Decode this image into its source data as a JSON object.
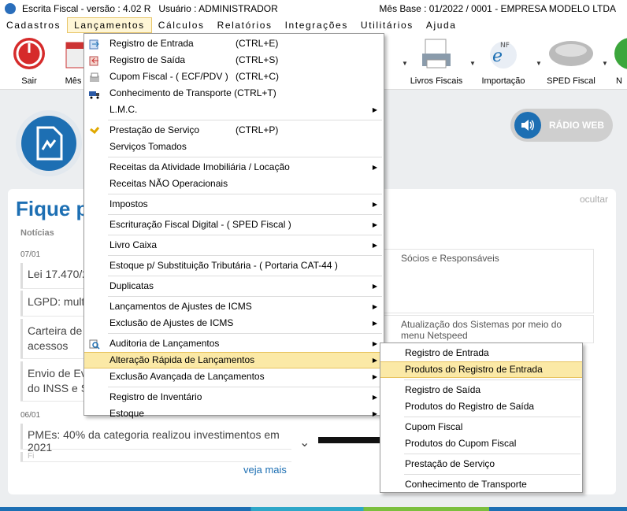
{
  "titlebar": {
    "title": "Escrita Fiscal - versão : 4.02 R",
    "user": "Usuário : ADMINISTRADOR",
    "base": "Mês Base : 01/2022 / 0001 - EMPRESA MODELO LTDA"
  },
  "menubar": [
    "Cadastros",
    "Lançamentos",
    "Cálculos",
    "Relatórios",
    "Integrações",
    "Utilitários",
    "Ajuda"
  ],
  "toolbar": {
    "sair": "Sair",
    "mes": "Mês",
    "livros": "Livros Fiscais",
    "importacao": "Importação",
    "sped": "SPED Fiscal",
    "n": "N"
  },
  "radio": "RÁDIO WEB",
  "fique": "Fique p",
  "ocultar": "ocultar",
  "noticias_header": "Notícias",
  "dates": [
    "07/01",
    "06/01"
  ],
  "news": [
    "Lei 17.470/2",
    "LGPD: multa",
    "Carteira de T\nacessos",
    "Envio de Eve\ndo INSS e S",
    "PMEs: 40% da categoria realizou investimentos em 2021",
    "Fi"
  ],
  "veja_mais": "veja mais",
  "cards": [
    "Sócios e Responsáveis",
    "Atualização dos Sistemas por meio do menu Netspeed"
  ],
  "menu_lancamentos": [
    {
      "label": "Registro de Entrada",
      "shortcut": "(CTRL+E)",
      "icon": "entrada-icon"
    },
    {
      "label": "Registro de Saída",
      "shortcut": "(CTRL+S)",
      "icon": "saida-icon"
    },
    {
      "label": "Cupom Fiscal - ( ECF/PDV )",
      "shortcut": "(CTRL+C)",
      "icon": "cupom-icon"
    },
    {
      "label": "Conhecimento de Transporte (CTRL+T)",
      "shortcut": "",
      "icon": "truck-icon"
    },
    {
      "label": "L.M.C.",
      "shortcut": "",
      "sub": true
    },
    {
      "sep": true
    },
    {
      "label": "Prestação de Serviço",
      "shortcut": "(CTRL+P)",
      "icon": "servico-icon"
    },
    {
      "label": "Serviços Tomados",
      "shortcut": ""
    },
    {
      "sep": true
    },
    {
      "label": "Receitas da Atividade Imobiliária / Locação",
      "shortcut": "",
      "sub": true
    },
    {
      "label": "Receitas NÃO Operacionais",
      "shortcut": ""
    },
    {
      "sep": true
    },
    {
      "label": "Impostos",
      "shortcut": "",
      "sub": true
    },
    {
      "sep": true
    },
    {
      "label": "Escrituração Fiscal Digital - ( SPED Fiscal )",
      "shortcut": "",
      "sub": true
    },
    {
      "sep": true
    },
    {
      "label": "Livro Caixa",
      "shortcut": "",
      "sub": true
    },
    {
      "sep": true
    },
    {
      "label": "Estoque p/ Substituição Tributária - ( Portaria CAT-44 )",
      "shortcut": ""
    },
    {
      "sep": true
    },
    {
      "label": "Duplicatas",
      "shortcut": "",
      "sub": true
    },
    {
      "sep": true
    },
    {
      "label": "Lançamentos de Ajustes de ICMS",
      "shortcut": "",
      "sub": true
    },
    {
      "label": "Exclusão de Ajustes de ICMS",
      "shortcut": "",
      "sub": true
    },
    {
      "sep": true
    },
    {
      "label": "Auditoria de Lançamentos",
      "shortcut": "",
      "sub": true,
      "icon": "auditoria-icon"
    },
    {
      "label": "Alteração Rápida de Lançamentos",
      "shortcut": "",
      "sub": true,
      "hl": true
    },
    {
      "label": "Exclusão Avançada de Lançamentos",
      "shortcut": "",
      "sub": true
    },
    {
      "sep": true
    },
    {
      "label": "Registro de Inventário",
      "shortcut": "",
      "sub": true
    },
    {
      "label": "Estoque",
      "shortcut": "",
      "sub": true
    }
  ],
  "menu_alteracao": [
    {
      "label": "Registro de Entrada"
    },
    {
      "label": "Produtos do Registro de Entrada",
      "hl": true
    },
    {
      "sep": true
    },
    {
      "label": "Registro de Saída"
    },
    {
      "label": "Produtos do Registro de Saída"
    },
    {
      "sep": true
    },
    {
      "label": "Cupom Fiscal"
    },
    {
      "label": "Produtos do Cupom Fiscal"
    },
    {
      "sep": true
    },
    {
      "label": "Prestação de Serviço"
    },
    {
      "sep": true
    },
    {
      "label": "Conhecimento de Transporte"
    }
  ],
  "colors": {
    "accent": "#1d6fb3",
    "highlight": "#fbe9a6"
  }
}
